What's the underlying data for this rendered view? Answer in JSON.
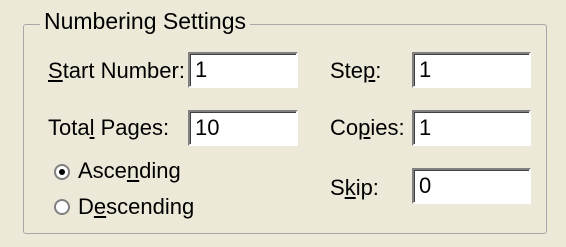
{
  "group": {
    "title": "Numbering Settings"
  },
  "fields": {
    "start_number": {
      "label_pre": "",
      "label_mnemonic": "S",
      "label_post": "tart Number:",
      "value": "1"
    },
    "total_pages": {
      "label_pre": "Tota",
      "label_mnemonic": "l",
      "label_post": " Pages:",
      "value": "10"
    },
    "step": {
      "label_pre": "Ste",
      "label_mnemonic": "p",
      "label_post": ":",
      "value": "1"
    },
    "copies": {
      "label_pre": "Co",
      "label_mnemonic": "p",
      "label_post": "ies:",
      "value": "1"
    },
    "skip": {
      "label_pre": "S",
      "label_mnemonic": "k",
      "label_post": "ip:",
      "value": "0"
    }
  },
  "order": {
    "ascending": {
      "label_pre": "Asce",
      "label_mnemonic": "n",
      "label_post": "ding",
      "selected": true
    },
    "descending": {
      "label_pre": "D",
      "label_mnemonic": "e",
      "label_post": "scending",
      "selected": false
    }
  }
}
